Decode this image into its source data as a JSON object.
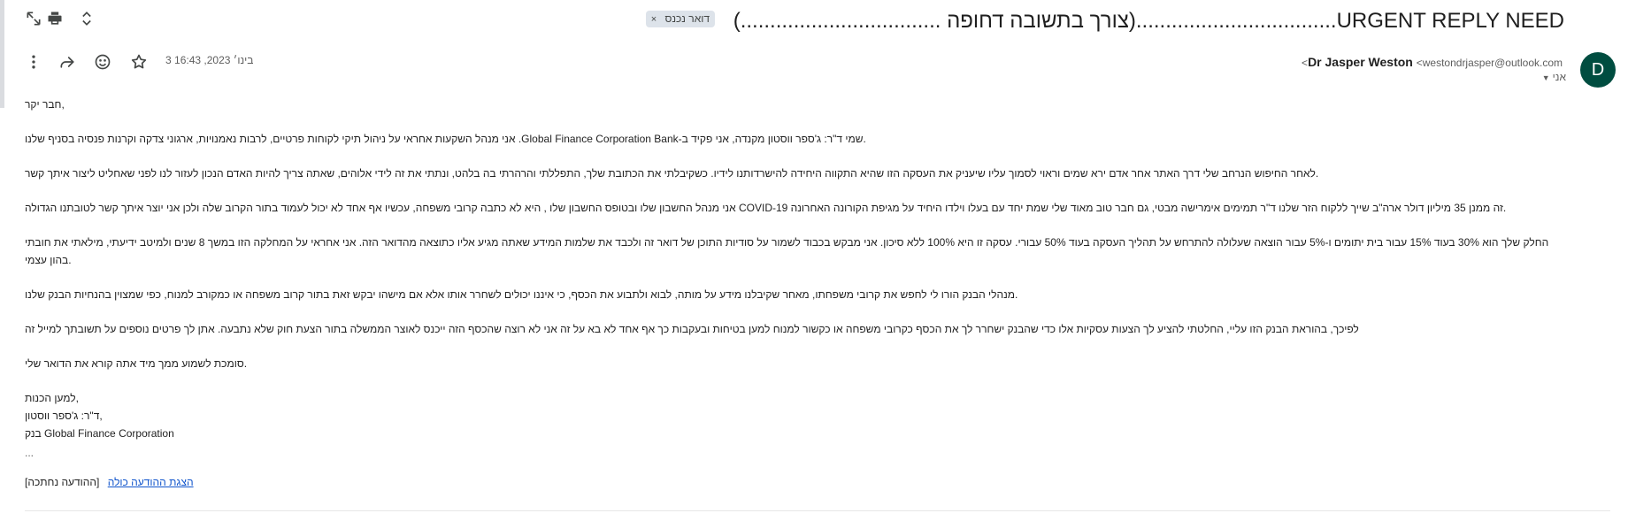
{
  "toolbar": {
    "icons": [
      "open-in-new-window-icon",
      "print-icon",
      "expand-collapse-icon"
    ]
  },
  "subject": {
    "text": "URGENT REPLY NEED..................................(צורך בתשובה דחופה ..................................)",
    "label_tag": "דואר נכנס",
    "label_remove": "×"
  },
  "sender": {
    "avatar_letter": "D",
    "avatar_color": "#004d40",
    "name": "Dr Jasper Weston",
    "email": "<westondrjasper@outlook.com>",
    "to": "אני"
  },
  "message": {
    "date": "3 בינו׳ 2023, 16:43",
    "actions": [
      "star-icon",
      "emoji-icon",
      "forward-icon",
      "more-vert-icon"
    ],
    "body": [
      "חבר יקר,",
      "אני מנהל השקעות אחראי על ניהול תיקי לקוחות פרטיים, לרבות נאמנויות, ארגוני צדקה וקרנות פנסיה בסניף שלנו .Global Finance Corporation Bank-שמי ד\"ר: ג'ספר ווסטון מקנדה, אני פקיד ב.",
      "לאחר החיפוש הנרחב שלי דרך האתר אחר אדם ירא שמים וראוי לסמוך עליו שיעניק את העסקה הזו שהיא התקווה היחידה להישרדותנו לידיו. כשקיבלתי את הכתובת שלך, התפללתי והרהרתי בה בלהט, ונתתי את זה לידי אלוהים, שאתה צריך להיות האדם הנכון לעזור לנו לפני שאחליט ליצור איתך קשר.",
      "אני מנהל החשבון שלו ובטופס החשבון שלו , היא לא כתבה קרובי משפחה, עכשיו אף אחד לא יכול לעמוד בתור הקרוב שלה ולכן אני יוצר איתך קשר לטובתנו הגדולה COVID-19 זה ממנן 35 מיליון דולר ארה\"ב שייך ללקוח הזר שלנו ד\"ר תמימים אימרישה מבטי, גם חבר טוב מאוד שלי שמת יחד עם בעלו וילדו היחיד על מגיפת הקורונה האחרונה.",
      "החלק שלך הוא 30% בעוד 15% עבור בית יתומים ו-5% עבור הוצאה שעלולה להתרחש על תהליך העסקה בעוד 50% עבורי. עסקה זו היא 100% ללא סיכון. אני מבקש בכבוד לשמור על סודיות התוכן של דואר זה ולכבד את שלמות המידע שאתה מגיע אליו כתוצאה מהדואר הזה. אני אחראי על המחלקה הזו במשך 8 שנים ולמיטב ידיעתי, מילאתי את חובתי בהון עצמי.",
      "מנהלי הבנק הורו לי לחפש את קרובי משפחתו, מאחר שקיבלנו מידע על מותה, לבוא ולתבוע את הכסף, כי איננו יכולים לשחרר אותו אלא אם מישהו יבקש זאת בתור קרוב משפחה או כמקורב למנוח, כפי שמצוין בהנחיות הבנק שלנו.",
      "לפיכך, בהוראת הבנק הזו עליי, החלטתי להציע לך הצעות עסקיות אלו כדי שהבנק ישחרר לך את הכסף כקרובי משפחה או כקשור למנוח למען בטיחות ובעקבות כך אף אחד לא בא על זה אני לא רוצה שהכסף הזה ייכנס לאוצר הממשלה בתור הצעת חוק שלא נתבעה. אתן לך פרטים נוספים על תשובתך למייל זה",
      "סומכת לשמוע ממך מיד אתה קורא את הדואר שלי."
    ],
    "signature": [
      "למען הכנות,",
      "ד\"ר: ג'ספר ווסטון,",
      "בנק Global Finance Corporation"
    ],
    "trimmed": "...",
    "clipped_note": "[ההודעה נחתכה]",
    "view_full": "הצגת ההודעה כולה"
  }
}
